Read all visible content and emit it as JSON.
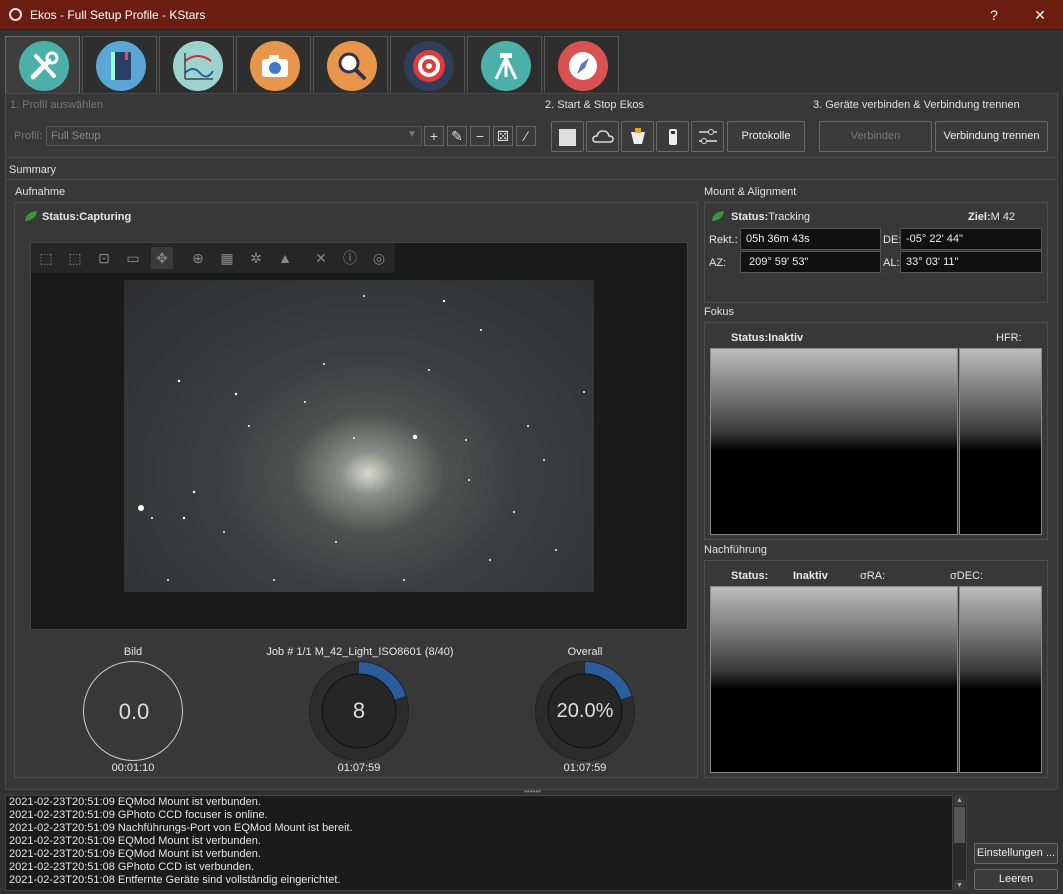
{
  "window": {
    "title": "Ekos - Full Setup Profile - KStars",
    "help": "?",
    "close": "✕"
  },
  "tabs": [
    {
      "name": "setup"
    },
    {
      "name": "scheduler"
    },
    {
      "name": "analyze"
    },
    {
      "name": "capture"
    },
    {
      "name": "focus"
    },
    {
      "name": "guide"
    },
    {
      "name": "mount"
    },
    {
      "name": "align"
    }
  ],
  "profile": {
    "section": "1. Profil auswählen",
    "label": "Profil:",
    "value": "Full Setup"
  },
  "startstop": {
    "section": "2. Start & Stop Ekos",
    "log_button": "Protokolle"
  },
  "devices": {
    "section": "3. Geräte verbinden & Verbindung trennen",
    "connect": "Verbinden",
    "disconnect": "Verbindung trennen"
  },
  "summary": {
    "label": "Summary"
  },
  "capture": {
    "title": "Aufnahme",
    "status_label": "Status:",
    "status_value": "Capturing",
    "image_label": "Bild",
    "image_value": "0.0",
    "image_time": "00:01:10",
    "job_label": "Job # 1/1 M_42_Light_ISO8601 (8/40)",
    "job_value": "8",
    "job_time": "01:07:59",
    "overall_label": "Overall",
    "overall_value": "20.0%",
    "overall_time": "01:07:59"
  },
  "mount": {
    "title": "Mount & Alignment",
    "status_label": "Status:",
    "status_value": "Tracking",
    "target_label": "Ziel:",
    "target_value": "M 42",
    "ra_label": "Rekt.:",
    "ra_value": "05h 36m 43s",
    "de_label": "DE:",
    "de_value": "-05° 22' 44\"",
    "az_label": "AZ:",
    "az_value": "209° 59' 53\"",
    "al_label": "AL:",
    "al_value": "33° 03' 11\""
  },
  "focus": {
    "title": "Fokus",
    "status_label": "Status:",
    "status_value": "Inaktiv",
    "hfr_label": "HFR:"
  },
  "guide": {
    "title": "Nachführung",
    "status_label": "Status:",
    "status_value": "Inaktiv",
    "ra_label": "σRA:",
    "dec_label": "σDEC:"
  },
  "log": [
    "2021-02-23T20:51:09 EQMod Mount ist verbunden.",
    "2021-02-23T20:51:09 GPhoto CCD focuser is online.",
    "2021-02-23T20:51:09 Nachführungs-Port von EQMod Mount ist bereit.",
    "2021-02-23T20:51:09 EQMod Mount ist verbunden.",
    "2021-02-23T20:51:09 EQMod Mount ist verbunden.",
    "2021-02-23T20:51:08 GPhoto CCD ist verbunden.",
    "2021-02-23T20:51:08 Entfernte Geräte sind vollständig eingerichtet."
  ],
  "side": {
    "settings": "Einstellungen ...",
    "clear": "Leeren"
  },
  "progress": {
    "job_fraction": 0.2,
    "overall_fraction": 0.2
  }
}
